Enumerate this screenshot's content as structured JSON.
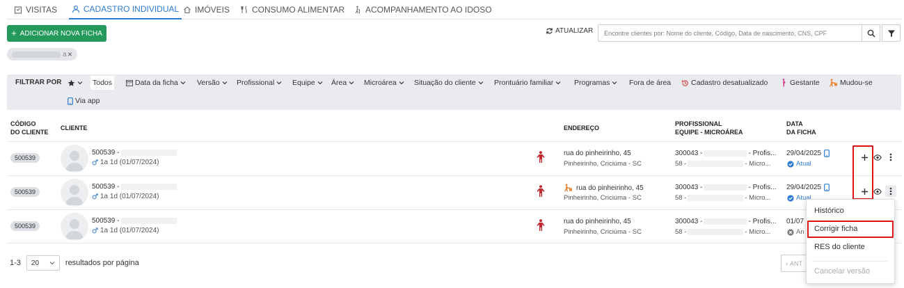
{
  "tabs": [
    {
      "label": "VISITAS",
      "icon": "clipboard-icon"
    },
    {
      "label": "CADASTRO INDIVIDUAL",
      "icon": "user-icon",
      "active": true
    },
    {
      "label": "IMÓVEIS",
      "icon": "home-icon"
    },
    {
      "label": "CONSUMO ALIMENTAR",
      "icon": "utensils-icon"
    },
    {
      "label": "ACOMPANHAMENTO AO IDOSO",
      "icon": "elderly-walk-icon"
    }
  ],
  "toolbar": {
    "add_label": "ADICIONAR NOVA FICHA",
    "refresh_label": "ATUALIZAR",
    "search_placeholder": "Encontre clientes por: Nome do cliente, Código, Data de nascimento, CNS, CPF",
    "chip_suffix": "a",
    "chip_close": "×"
  },
  "filters": {
    "label": "FILTRAR POR",
    "items": [
      "Todos",
      "Data da ficha",
      "Versão",
      "Profissional",
      "Equipe",
      "Área",
      "Microárea",
      "Situação do cliente",
      "Prontuário familiar",
      "Programas",
      "Fora de área",
      "Cadastro desatualizado",
      "Gestante",
      "Mudou-se",
      "Via app"
    ]
  },
  "table": {
    "headers": {
      "code_line1": "CÓDIGO",
      "code_line2": "DO CLIENTE",
      "client": "CLIENTE",
      "address": "ENDEREÇO",
      "prof_line1": "PROFISSIONAL",
      "prof_line2": "EQUIPE - MICROÁREA",
      "date_line1": "DATA",
      "date_line2": "DA FICHA"
    },
    "rows": [
      {
        "code": "500539",
        "name_prefix": "500539 -",
        "age": "1a 1d (01/07/2024)",
        "address_line1": "rua do pinheirinho, 45",
        "address_line2": "Pinheirinho, Criciúma - SC",
        "prof_prefix": "300043 -",
        "prof_suffix": "- Profis...",
        "team_prefix": "58 -",
        "team_suffix": "- Micro...",
        "date": "29/04/2025",
        "status": "Atual"
      },
      {
        "code": "500539",
        "name_prefix": "500539 -",
        "age": "1a 1d (01/07/2024)",
        "address_line1": "rua do pinheirinho, 45",
        "address_line2": "Pinheirinho, Criciúma - SC",
        "prof_prefix": "300043 -",
        "prof_suffix": "- Profis...",
        "team_prefix": "58 -",
        "team_suffix": "- Micro...",
        "date": "29/04/2025",
        "status": "Atual"
      },
      {
        "code": "500539",
        "name_prefix": "500539 -",
        "age": "1a 1d (01/07/2024)",
        "address_line1": "rua do pinheirinho, 45",
        "address_line2": "Pinheirinho, Criciúma - SC",
        "prof_prefix": "300043 -",
        "prof_suffix": "- Profis...",
        "team_prefix": "58 -",
        "team_suffix": "- Micro...",
        "date": "01/07",
        "status": "An"
      }
    ]
  },
  "pagination": {
    "range": "1-3",
    "per_page": "20",
    "per_page_label": "resultados por página",
    "prev_label": "ANT"
  },
  "context_menu": {
    "items": [
      "Histórico",
      "Corrigir ficha",
      "RES do cliente",
      "Cancelar versão"
    ]
  },
  "colors": {
    "accent": "#2d7bd0",
    "add_button": "#239a5c",
    "highlight": "#e01313",
    "elderly_icon": "#c0282e",
    "moved_icon": "#e8873a",
    "pregnant_icon": "#d4388f"
  }
}
